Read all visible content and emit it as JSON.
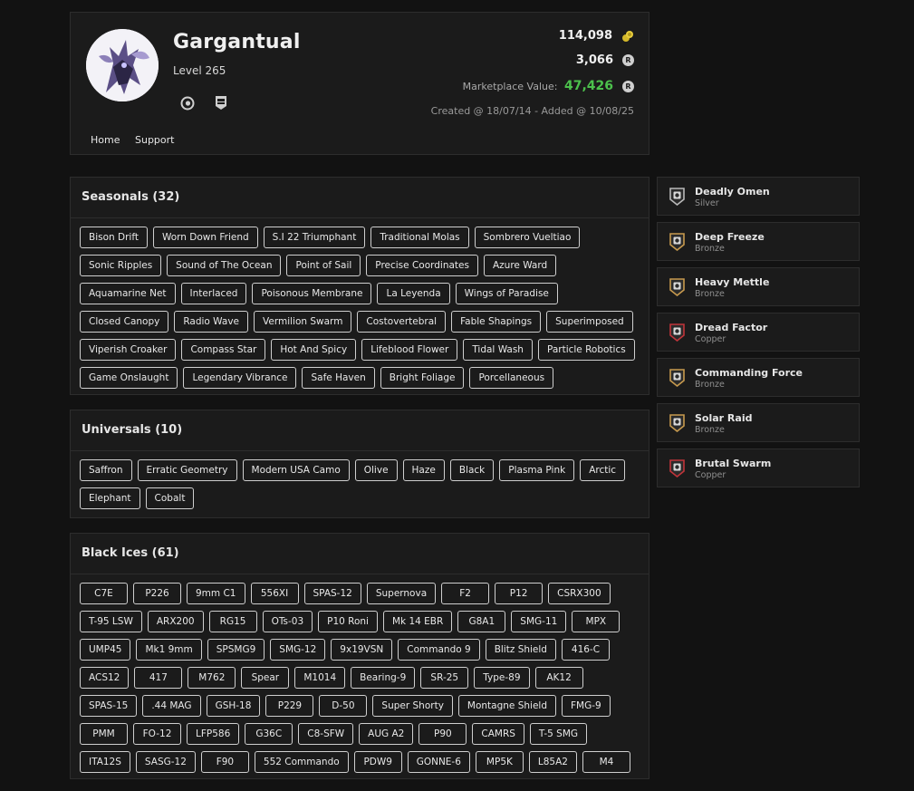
{
  "profile": {
    "username": "Gargantual",
    "level": "Level 265",
    "credits": "114,098",
    "renown": "3,066",
    "market_label": "Marketplace Value:",
    "market_value": "47,426",
    "created": "Created @ 18/07/14 - Added @ 10/08/25",
    "coin_glyph": "R",
    "nav": {
      "home": "Home",
      "support": "Support"
    },
    "colors": {
      "market_value": "#4cc14c",
      "accent_yellow": "#d4b82a"
    }
  },
  "seasonals": {
    "title": "Seasonals (32)",
    "items": [
      "Bison Drift",
      "Worn Down Friend",
      "S.I 22 Triumphant",
      "Traditional Molas",
      "Sombrero Vueltiao",
      "Sonic Ripples",
      "Sound of The Ocean",
      "Point of Sail",
      "Precise Coordinates",
      "Azure Ward",
      "Aquamarine Net",
      "Interlaced",
      "Poisonous Membrane",
      "La Leyenda",
      "Wings of Paradise",
      "Closed Canopy",
      "Radio Wave",
      "Vermilion Swarm",
      "Costovertebral",
      "Fable Shapings",
      "Superimposed",
      "Viperish Croaker",
      "Compass Star",
      "Hot And Spicy",
      "Lifeblood Flower",
      "Tidal Wash",
      "Particle Robotics",
      "Game Onslaught",
      "Legendary Vibrance",
      "Safe Haven",
      "Bright Foliage",
      "Porcellaneous"
    ]
  },
  "universals": {
    "title": "Universals (10)",
    "items": [
      "Saffron",
      "Erratic Geometry",
      "Modern USA Camo",
      "Olive",
      "Haze",
      "Black",
      "Plasma Pink",
      "Arctic",
      "Elephant",
      "Cobalt"
    ]
  },
  "black_ices": {
    "title": "Black Ices (61)",
    "items": [
      "C7E",
      "P226",
      "9mm C1",
      "556XI",
      "SPAS-12",
      "Supernova",
      "F2",
      "P12",
      "CSRX300",
      "T-95 LSW",
      "ARX200",
      "RG15",
      "OTs-03",
      "P10 Roni",
      "Mk 14 EBR",
      "G8A1",
      "SMG-11",
      "MPX",
      "UMP45",
      "Mk1 9mm",
      "SPSMG9",
      "SMG-12",
      "9x19VSN",
      "Commando 9",
      "Blitz Shield",
      "416-C",
      "ACS12",
      "417",
      "M762",
      "Spear",
      "M1014",
      "Bearing-9",
      "SR-25",
      "Type-89",
      "AK12",
      "SPAS-15",
      ".44 MAG",
      "GSH-18",
      "P229",
      "D-50",
      "Super Shorty",
      "Montagne Shield",
      "FMG-9",
      "PMM",
      "FO-12",
      "LFP586",
      "G36C",
      "C8-SFW",
      "AUG A2",
      "P90",
      "CAMRS",
      "T-5 SMG",
      "ITA12S",
      "SASG-12",
      "F90",
      "552 Commando",
      "PDW9",
      "GONNE-6",
      "MP5K",
      "L85A2",
      "M4"
    ]
  },
  "charms": [
    {
      "name": "Deadly Omen",
      "tier": "Silver",
      "color": "#b9b9b9",
      "icon": "shield-badge-icon"
    },
    {
      "name": "Deep Freeze",
      "tier": "Bronze",
      "color": "#c79a4e",
      "icon": "shield-badge-icon"
    },
    {
      "name": "Heavy Mettle",
      "tier": "Bronze",
      "color": "#c79a4e",
      "icon": "shield-badge-icon"
    },
    {
      "name": "Dread Factor",
      "tier": "Copper",
      "color": "#c0343a",
      "icon": "shield-badge-icon"
    },
    {
      "name": "Commanding Force",
      "tier": "Bronze",
      "color": "#c79a4e",
      "icon": "shield-badge-icon"
    },
    {
      "name": "Solar Raid",
      "tier": "Bronze",
      "color": "#c79a4e",
      "icon": "shield-badge-icon"
    },
    {
      "name": "Brutal Swarm",
      "tier": "Copper",
      "color": "#c0343a",
      "icon": "shield-badge-icon"
    }
  ]
}
